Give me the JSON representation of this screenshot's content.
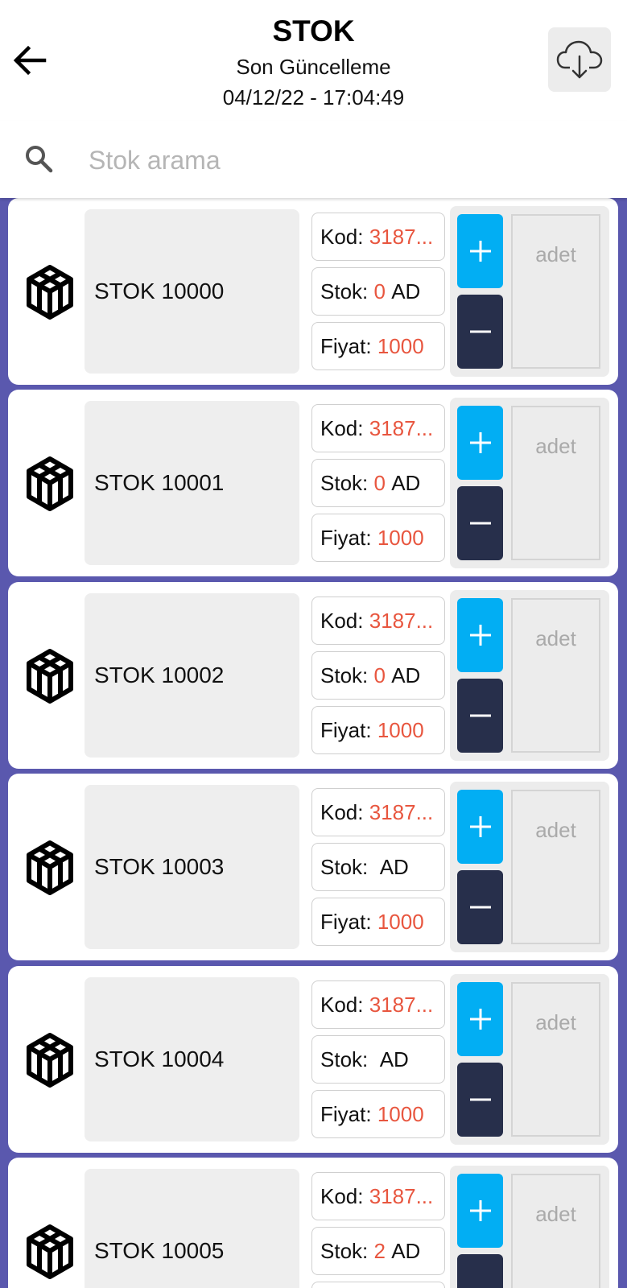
{
  "header": {
    "title": "STOK",
    "subtitle": "Son Güncelleme",
    "timestamp": "04/12/22 - 17:04:49"
  },
  "search": {
    "placeholder": "Stok arama",
    "value": ""
  },
  "labels": {
    "kod": "Kod:",
    "stok": "Stok:",
    "unit": "AD",
    "fiyat": "Fiyat:",
    "qty_placeholder": "adet"
  },
  "items": [
    {
      "name": "STOK 10000",
      "kod": "3187...",
      "stok": "0",
      "fiyat": "1000"
    },
    {
      "name": "STOK 10001",
      "kod": "3187...",
      "stok": "0",
      "fiyat": "1000"
    },
    {
      "name": "STOK 10002",
      "kod": "3187...",
      "stok": "0",
      "fiyat": "1000"
    },
    {
      "name": "STOK 10003",
      "kod": "3187...",
      "stok": "",
      "fiyat": "1000"
    },
    {
      "name": "STOK 10004",
      "kod": "3187...",
      "stok": "",
      "fiyat": "1000"
    },
    {
      "name": "STOK 10005",
      "kod": "3187...",
      "stok": "2",
      "fiyat": "1000"
    }
  ],
  "icons": {
    "back": "arrow-left-icon",
    "cloud": "cloud-download-icon",
    "search": "search-icon",
    "item": "codepen-cube-icon",
    "plus": "plus-icon",
    "minus": "minus-icon"
  },
  "colors": {
    "list_background": "#5a58ae",
    "value_red": "#e8563f",
    "plus_button": "#02aef3",
    "minus_button": "#272f4b"
  }
}
